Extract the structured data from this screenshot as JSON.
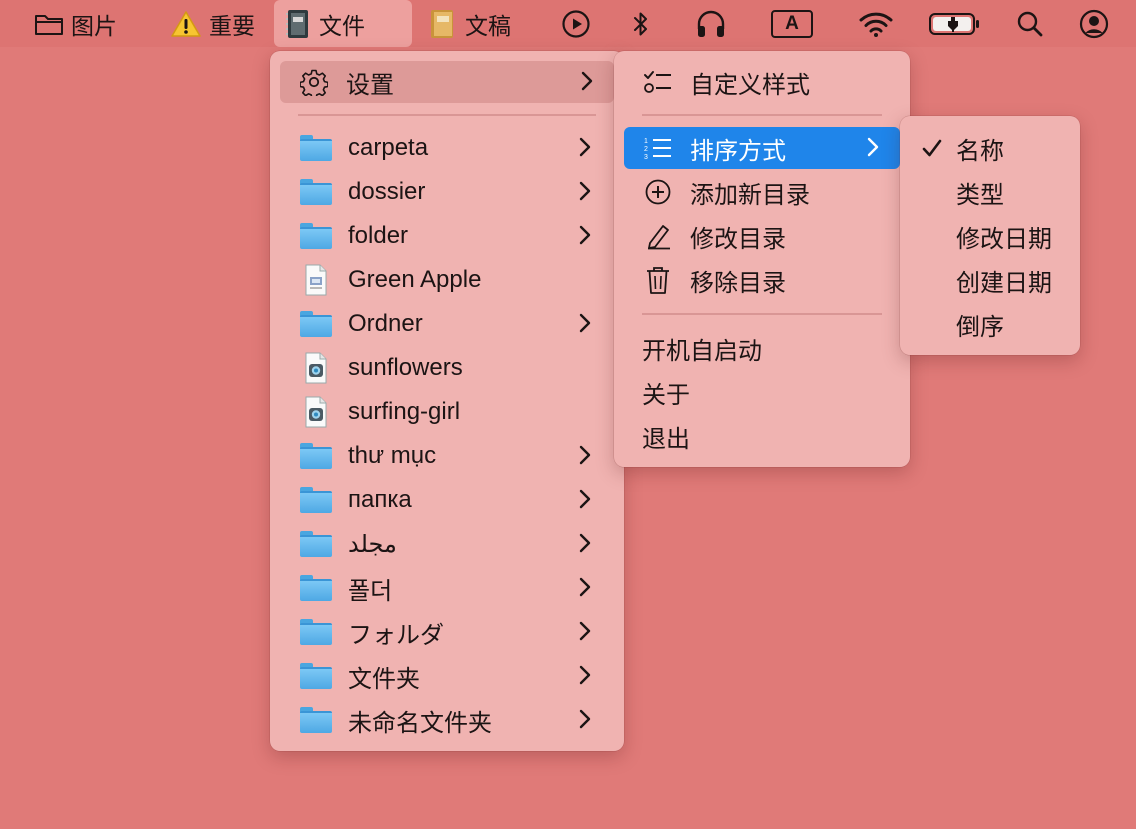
{
  "menubar": {
    "items": [
      {
        "icon": "folder-outline-icon",
        "label": "图片"
      },
      {
        "icon": "warning-icon",
        "label": "重要"
      },
      {
        "icon": "notebook-icon",
        "label": "文件"
      },
      {
        "icon": "book-icon",
        "label": "文稿"
      }
    ],
    "status_icons": [
      "play-circle-icon",
      "bluetooth-icon",
      "headphones-icon",
      "input-source-icon",
      "wifi-icon",
      "battery-charging-icon",
      "search-icon",
      "user-account-icon"
    ],
    "input_source_label": "A"
  },
  "main_menu": {
    "settings_label": "设置",
    "items": [
      {
        "label": "carpeta",
        "type": "folder",
        "submenu": true
      },
      {
        "label": "dossier",
        "type": "folder",
        "submenu": true
      },
      {
        "label": "folder",
        "type": "folder",
        "submenu": true
      },
      {
        "label": "Green Apple",
        "type": "document",
        "submenu": false
      },
      {
        "label": "Ordner",
        "type": "folder",
        "submenu": true
      },
      {
        "label": "sunflowers",
        "type": "image",
        "submenu": false
      },
      {
        "label": "surfing-girl",
        "type": "image",
        "submenu": false
      },
      {
        "label": "thư mục",
        "type": "folder",
        "submenu": true
      },
      {
        "label": "папка",
        "type": "folder",
        "submenu": true
      },
      {
        "label": "مجلد",
        "type": "folder",
        "submenu": true
      },
      {
        "label": "폴더",
        "type": "folder",
        "submenu": true
      },
      {
        "label": "フォルダ",
        "type": "folder",
        "submenu": true
      },
      {
        "label": "文件夹",
        "type": "folder",
        "submenu": true
      },
      {
        "label": "未命名文件夹",
        "type": "folder",
        "submenu": true
      }
    ]
  },
  "settings_menu": {
    "custom_style": "自定义样式",
    "sort_by": "排序方式",
    "add_dir": "添加新目录",
    "edit_dir": "修改目录",
    "remove_dir": "移除目录",
    "launch_at_login": "开机自启动",
    "about": "关于",
    "quit": "退出"
  },
  "sort_menu": {
    "checked": "名称",
    "options": [
      "名称",
      "类型",
      "修改日期",
      "创建日期",
      "倒序"
    ]
  },
  "colors": {
    "desktop": "#e07a78",
    "menu_bg": "#f0b3b1",
    "selected": "#1f85ea"
  }
}
